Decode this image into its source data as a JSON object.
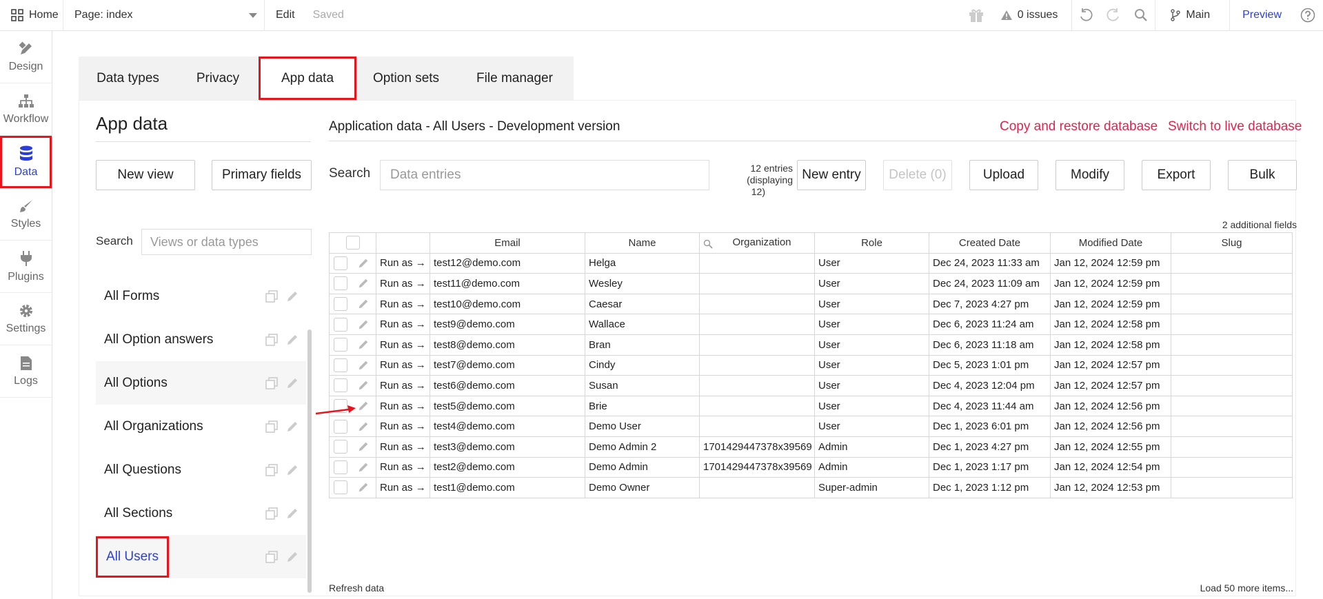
{
  "topbar": {
    "home_label": "Home",
    "page_label": "Page: index",
    "edit_label": "Edit",
    "saved_label": "Saved",
    "issues_label": "0 issues",
    "branch_label": "Main",
    "preview_label": "Preview"
  },
  "leftnav": {
    "items": [
      {
        "label": "Design",
        "icon": "design-icon"
      },
      {
        "label": "Workflow",
        "icon": "workflow-icon"
      },
      {
        "label": "Data",
        "icon": "database-icon"
      },
      {
        "label": "Styles",
        "icon": "brush-icon"
      },
      {
        "label": "Plugins",
        "icon": "plug-icon"
      },
      {
        "label": "Settings",
        "icon": "gear-icon"
      },
      {
        "label": "Logs",
        "icon": "document-icon"
      }
    ]
  },
  "tabs": [
    "Data types",
    "Privacy",
    "App data",
    "Option sets",
    "File manager"
  ],
  "sidebar": {
    "title": "App data",
    "new_view": "New view",
    "primary_fields": "Primary fields",
    "search_label": "Search",
    "search_placeholder": "Views or data types",
    "views": [
      "All Forms",
      "All Option answers",
      "All Options",
      "All Organizations",
      "All Questions",
      "All Sections",
      "All Users"
    ]
  },
  "main": {
    "title": "Application data - All Users - Development version",
    "copy_restore": "Copy and restore database",
    "switch_live": "Switch to live database",
    "search_label": "Search",
    "search_placeholder": "Data entries",
    "entries_line1": "12 entries",
    "entries_line2": "(displaying",
    "entries_line3": "12)",
    "buttons": {
      "new_entry": "New entry",
      "delete": "Delete (0)",
      "upload": "Upload",
      "modify": "Modify",
      "export": "Export",
      "bulk": "Bulk"
    },
    "additional_fields": "2 additional fields",
    "columns": [
      "Email",
      "Name",
      "Organization",
      "Role",
      "Created Date",
      "Modified Date",
      "Slug"
    ],
    "run_as": "Run as →",
    "rows": [
      {
        "email": "test12@demo.com",
        "name": "Helga",
        "org": "",
        "role": "User",
        "created": "Dec 24, 2023 11:33 am",
        "modified": "Jan 12, 2024 12:59 pm",
        "slug": ""
      },
      {
        "email": "test11@demo.com",
        "name": "Wesley",
        "org": "",
        "role": "User",
        "created": "Dec 24, 2023 11:09 am",
        "modified": "Jan 12, 2024 12:59 pm",
        "slug": ""
      },
      {
        "email": "test10@demo.com",
        "name": "Caesar",
        "org": "",
        "role": "User",
        "created": "Dec 7, 2023 4:27 pm",
        "modified": "Jan 12, 2024 12:59 pm",
        "slug": ""
      },
      {
        "email": "test9@demo.com",
        "name": "Wallace",
        "org": "",
        "role": "User",
        "created": "Dec 6, 2023 11:24 am",
        "modified": "Jan 12, 2024 12:58 pm",
        "slug": ""
      },
      {
        "email": "test8@demo.com",
        "name": "Bran",
        "org": "",
        "role": "User",
        "created": "Dec 6, 2023 11:18 am",
        "modified": "Jan 12, 2024 12:58 pm",
        "slug": ""
      },
      {
        "email": "test7@demo.com",
        "name": "Cindy",
        "org": "",
        "role": "User",
        "created": "Dec 5, 2023 1:01 pm",
        "modified": "Jan 12, 2024 12:57 pm",
        "slug": ""
      },
      {
        "email": "test6@demo.com",
        "name": "Susan",
        "org": "",
        "role": "User",
        "created": "Dec 4, 2023 12:04 pm",
        "modified": "Jan 12, 2024 12:57 pm",
        "slug": ""
      },
      {
        "email": "test5@demo.com",
        "name": "Brie",
        "org": "",
        "role": "User",
        "created": "Dec 4, 2023 11:44 am",
        "modified": "Jan 12, 2024 12:56 pm",
        "slug": ""
      },
      {
        "email": "test4@demo.com",
        "name": "Demo User",
        "org": "",
        "role": "User",
        "created": "Dec 1, 2023 6:01 pm",
        "modified": "Jan 12, 2024 12:56 pm",
        "slug": ""
      },
      {
        "email": "test3@demo.com",
        "name": "Demo Admin 2",
        "org": "1701429447378x39569",
        "role": "Admin",
        "created": "Dec 1, 2023 4:27 pm",
        "modified": "Jan 12, 2024 12:55 pm",
        "slug": ""
      },
      {
        "email": "test2@demo.com",
        "name": "Demo Admin",
        "org": "1701429447378x39569",
        "role": "Admin",
        "created": "Dec 1, 2023 1:17 pm",
        "modified": "Jan 12, 2024 12:54 pm",
        "slug": ""
      },
      {
        "email": "test1@demo.com",
        "name": "Demo Owner",
        "org": "",
        "role": "Super-admin",
        "created": "Dec 1, 2023 1:12 pm",
        "modified": "Jan 12, 2024 12:53 pm",
        "slug": ""
      }
    ],
    "refresh": "Refresh data",
    "load_more": "Load 50 more items..."
  },
  "colors": {
    "accent": "#2b3fd6",
    "highlight": "#e8141b",
    "link_red": "#e0244e"
  }
}
